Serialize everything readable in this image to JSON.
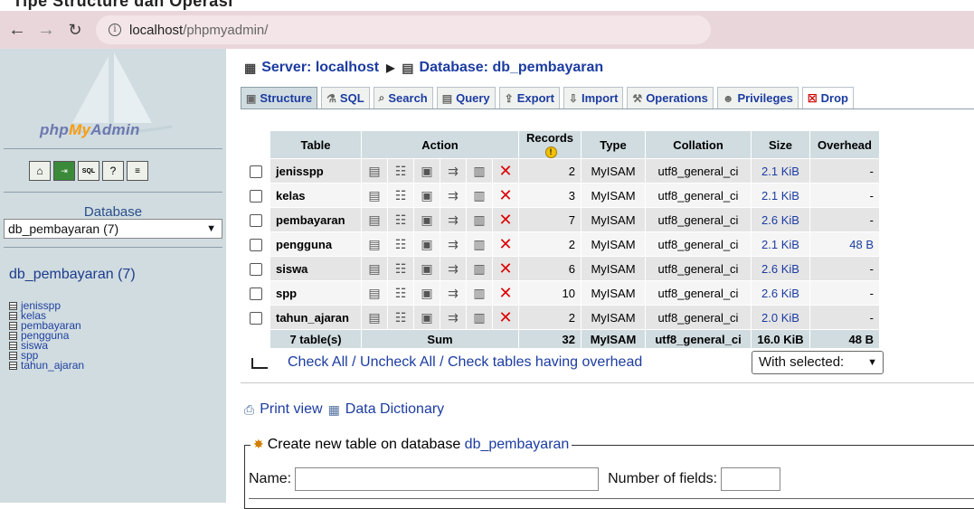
{
  "browser": {
    "url_host": "localhost",
    "url_path": "/phpmyadmin/",
    "top_strip_text": "Tipe Structure dan Operasi"
  },
  "sidebar": {
    "logo_php": "php",
    "logo_my": "My",
    "logo_admin": "Admin",
    "database_label": "Database",
    "database_select_value": "db_pembayaran (7)",
    "db_title": "db_pembayaran (7)",
    "tables": [
      "jenisspp",
      "kelas",
      "pembayaran",
      "pengguna",
      "siswa",
      "spp",
      "tahun_ajaran"
    ]
  },
  "header": {
    "server_label": "Server: localhost",
    "database_label": "Database: db_pembayaran"
  },
  "tabs": [
    {
      "label": "Structure",
      "icon": "structure-icon"
    },
    {
      "label": "SQL",
      "icon": "sql-icon"
    },
    {
      "label": "Search",
      "icon": "search-icon"
    },
    {
      "label": "Query",
      "icon": "query-icon"
    },
    {
      "label": "Export",
      "icon": "export-icon"
    },
    {
      "label": "Import",
      "icon": "import-icon"
    },
    {
      "label": "Operations",
      "icon": "operations-icon"
    },
    {
      "label": "Privileges",
      "icon": "privileges-icon"
    },
    {
      "label": "Drop",
      "icon": "drop-icon"
    }
  ],
  "table_headers": {
    "table": "Table",
    "action": "Action",
    "records": "Records",
    "type": "Type",
    "collation": "Collation",
    "size": "Size",
    "overhead": "Overhead"
  },
  "rows": [
    {
      "name": "jenisspp",
      "records": "2",
      "type": "MyISAM",
      "collation": "utf8_general_ci",
      "size": "2.1 KiB",
      "overhead": "-"
    },
    {
      "name": "kelas",
      "records": "3",
      "type": "MyISAM",
      "collation": "utf8_general_ci",
      "size": "2.1 KiB",
      "overhead": "-"
    },
    {
      "name": "pembayaran",
      "records": "7",
      "type": "MyISAM",
      "collation": "utf8_general_ci",
      "size": "2.6 KiB",
      "overhead": "-"
    },
    {
      "name": "pengguna",
      "records": "2",
      "type": "MyISAM",
      "collation": "utf8_general_ci",
      "size": "2.1 KiB",
      "overhead": "48 B"
    },
    {
      "name": "siswa",
      "records": "6",
      "type": "MyISAM",
      "collation": "utf8_general_ci",
      "size": "2.6 KiB",
      "overhead": "-"
    },
    {
      "name": "spp",
      "records": "10",
      "type": "MyISAM",
      "collation": "utf8_general_ci",
      "size": "2.6 KiB",
      "overhead": "-"
    },
    {
      "name": "tahun_ajaran",
      "records": "2",
      "type": "MyISAM",
      "collation": "utf8_general_ci",
      "size": "2.0 KiB",
      "overhead": "-"
    }
  ],
  "footer": {
    "tables": "7 table(s)",
    "sum": "Sum",
    "records": "32",
    "type": "MyISAM",
    "collation": "utf8_general_ci",
    "size": "16.0 KiB",
    "overhead": "48 B"
  },
  "check": {
    "check_all": "Check All",
    "sep": " / ",
    "uncheck_all": "Uncheck All",
    "check_overhead": "Check tables having overhead",
    "with_selected": "With selected:"
  },
  "links": {
    "print_view": "Print view",
    "data_dictionary": "Data Dictionary"
  },
  "create": {
    "legend_text": "Create new table on database ",
    "legend_db": "db_pembayaran",
    "name_label": "Name:",
    "fields_label": "Number of fields:",
    "name_value": "",
    "fields_value": ""
  },
  "colors": {
    "link": "#1c3ca0",
    "sidebar_bg": "#d0dce0",
    "drop_icon": "#cc0000",
    "browser_bar": "#e9d6db"
  }
}
